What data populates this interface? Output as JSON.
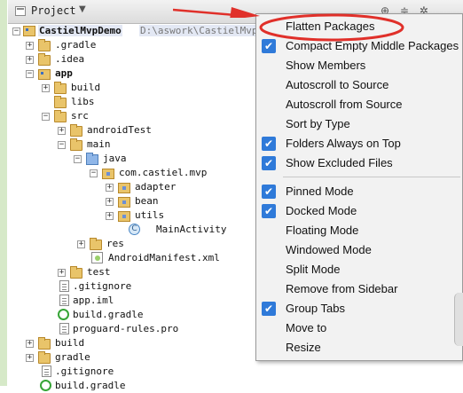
{
  "header": {
    "title": "Project",
    "dropdown_icon": "triangle-down-icon"
  },
  "tree": {
    "rows": [
      {
        "label": "CastielMvpDemo",
        "path": "D:\\aswork\\CastielMvpDemo",
        "icon": "module-icon"
      },
      {
        "label": ".gradle",
        "icon": "folder-icon"
      },
      {
        "label": ".idea",
        "icon": "folder-icon"
      },
      {
        "label": "app",
        "icon": "module-icon"
      },
      {
        "label": "build",
        "icon": "folder-icon"
      },
      {
        "label": "libs",
        "icon": "folder-icon"
      },
      {
        "label": "src",
        "icon": "folder-icon"
      },
      {
        "label": "androidTest",
        "icon": "folder-icon"
      },
      {
        "label": "main",
        "icon": "folder-icon"
      },
      {
        "label": "java",
        "icon": "source-folder-icon"
      },
      {
        "label": "com.castiel.mvp",
        "icon": "package-icon"
      },
      {
        "label": "adapter",
        "icon": "package-icon"
      },
      {
        "label": "bean",
        "icon": "package-icon"
      },
      {
        "label": "utils",
        "icon": "package-icon"
      },
      {
        "label": "MainActivity",
        "icon": "class-icon",
        "badge": "C"
      },
      {
        "label": "res",
        "icon": "resource-folder-icon"
      },
      {
        "label": "AndroidManifest.xml",
        "icon": "manifest-icon"
      },
      {
        "label": "test",
        "icon": "folder-icon"
      },
      {
        "label": ".gitignore",
        "icon": "file-icon"
      },
      {
        "label": "app.iml",
        "icon": "file-icon"
      },
      {
        "label": "build.gradle",
        "icon": "gradle-icon"
      },
      {
        "label": "proguard-rules.pro",
        "icon": "file-icon"
      },
      {
        "label": "build",
        "icon": "folder-icon"
      },
      {
        "label": "gradle",
        "icon": "folder-icon"
      },
      {
        "label": ".gitignore",
        "icon": "file-icon"
      },
      {
        "label": "build.gradle",
        "icon": "gradle-icon"
      }
    ]
  },
  "menu": {
    "items": [
      {
        "label": "Flatten Packages",
        "checked": false
      },
      {
        "label": "Compact Empty Middle Packages",
        "checked": true
      },
      {
        "label": "Show Members",
        "checked": false
      },
      {
        "label": "Autoscroll to Source",
        "checked": false
      },
      {
        "label": "Autoscroll from Source",
        "checked": false
      },
      {
        "label": "Sort by Type",
        "checked": false
      },
      {
        "label": "Folders Always on Top",
        "checked": true
      },
      {
        "label": "Show Excluded Files",
        "checked": true
      },
      {
        "label": "Pinned Mode",
        "checked": true
      },
      {
        "label": "Docked Mode",
        "checked": true
      },
      {
        "label": "Floating Mode",
        "checked": false
      },
      {
        "label": "Windowed Mode",
        "checked": false
      },
      {
        "label": "Split Mode",
        "checked": false
      },
      {
        "label": "Remove from Sidebar",
        "checked": false
      },
      {
        "label": "Group Tabs",
        "checked": true
      },
      {
        "label": "Move to",
        "checked": false
      },
      {
        "label": "Resize",
        "checked": false
      }
    ]
  },
  "colors": {
    "annotation": "#e0302a",
    "check_bg": "#2f7ad9",
    "menu_bg": "#f2f2f2"
  }
}
